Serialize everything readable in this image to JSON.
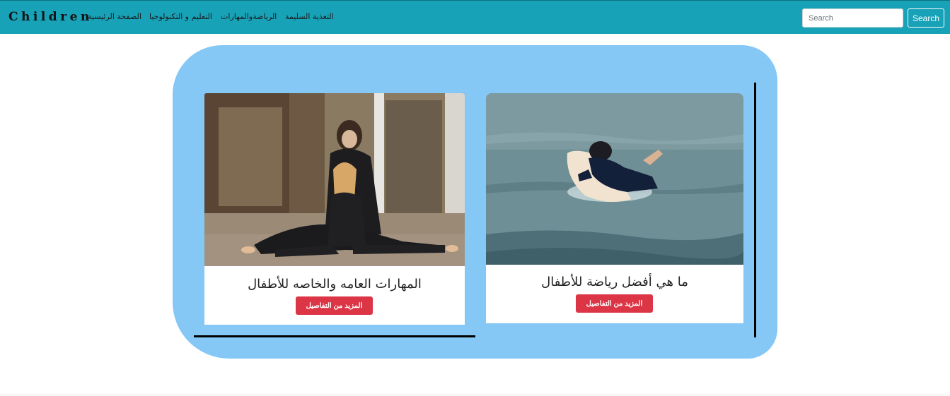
{
  "navbar": {
    "brand": "Children",
    "links": [
      "الصفحة الرئيسية",
      "التعليم و التكنولوجيا",
      "الرياضةوالمهارات",
      "التغذية السليمة"
    ],
    "search": {
      "placeholder": "Search",
      "value": "",
      "button_label": "Search"
    },
    "background_color": "#17a2b8"
  },
  "main": {
    "panel_color": "#85c7f5",
    "cards": [
      {
        "title": "المهارات العامه والخاصه للأطفال",
        "button_label": "المزيد من التفاصيل",
        "image": "girl-gymnastics-photo"
      },
      {
        "title": "ما هي أفضل رياضة للأطفال",
        "button_label": "المزيد من التفاصيل",
        "image": "child-surfing-photo"
      }
    ],
    "button_color": "#dc3545"
  }
}
